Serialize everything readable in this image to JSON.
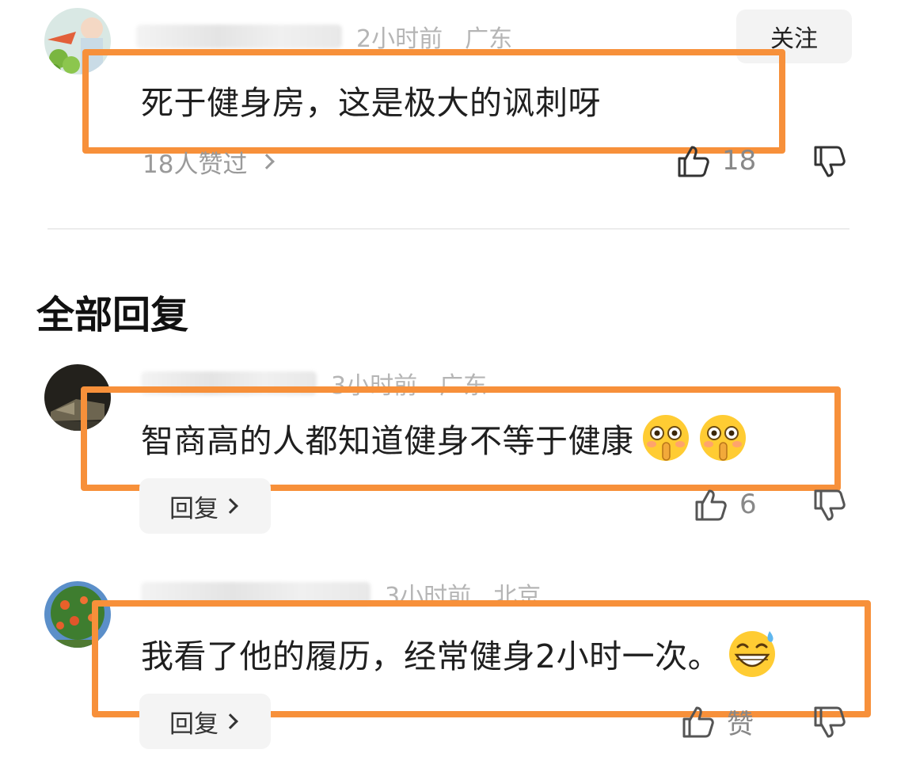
{
  "colors": {
    "highlight": "#f7903a",
    "muted": "#9a9a9a"
  },
  "main_comment": {
    "time": "2小时前",
    "location": "广东",
    "follow_label": "关注",
    "text": "死于健身房，这是极大的讽刺呀",
    "likes_link": "18人赞过",
    "like_count": "18"
  },
  "replies_section": {
    "title": "全部回复"
  },
  "replies": [
    {
      "time": "3小时前",
      "location": "广东",
      "text": "智商高的人都知道健身不等于健康",
      "emoji": [
        "finger-on-lips-emoji",
        "finger-on-lips-emoji"
      ],
      "reply_label": "回复",
      "like_count": "6"
    },
    {
      "time": "3小时前",
      "location": "北京",
      "text": "我看了他的履历，经常健身2小时一次。",
      "emoji": [
        "grinning-sweat-emoji"
      ],
      "reply_label": "回复",
      "like_label": "赞"
    }
  ]
}
